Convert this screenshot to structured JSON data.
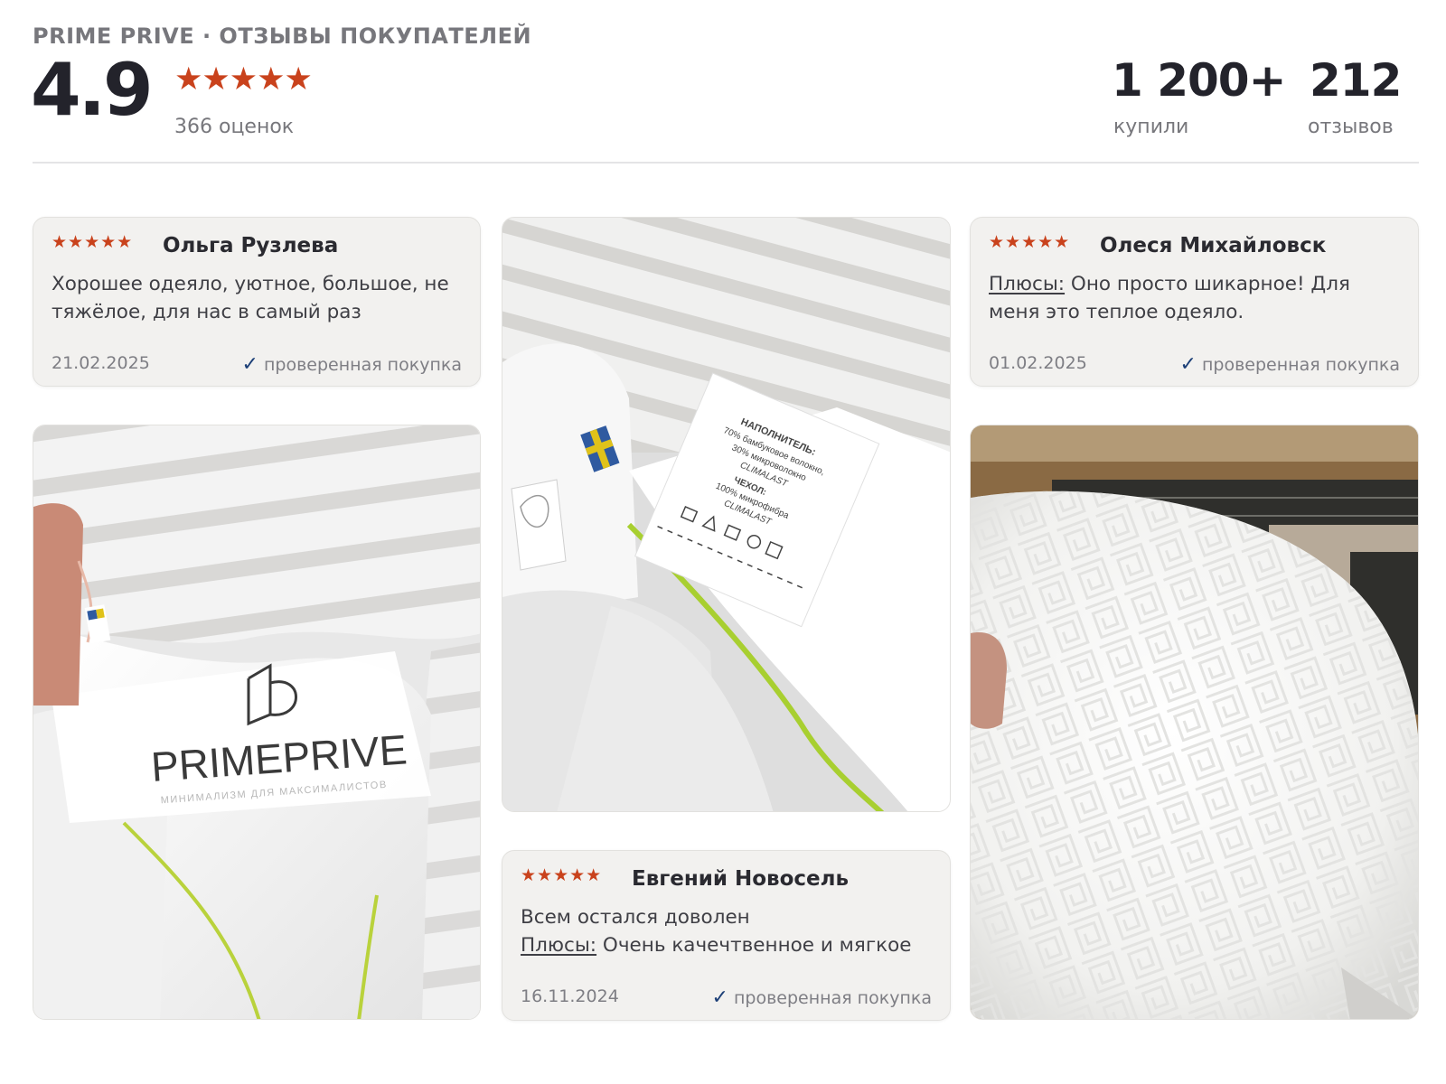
{
  "header": {
    "brand_line": "PRIME PRIVE · ОТЗЫВЫ ПОКУПАТЕЛЕЙ",
    "rating": "4.9",
    "stars": "★★★★★",
    "ratings_count": "366 оценок",
    "stats": [
      {
        "value": "1 200+",
        "label": "купили"
      },
      {
        "value": "212",
        "label": "отзывов"
      }
    ]
  },
  "reviews": [
    {
      "stars": "★★★★★",
      "author": "Ольга Рузлева",
      "text": "Хорошее одеяло, уютное, большое, не тяжёлое, для нас в самый раз",
      "date": "21.02.2025",
      "verified": "проверенная покупка"
    },
    {
      "stars": "★★★★★",
      "author": "Олеся Михайловск",
      "pros_label": "Плюсы:",
      "text": "Оно просто шикарное! Для меня это теплое одеяло.",
      "date": "01.02.2025",
      "verified": "проверенная покупка"
    },
    {
      "stars": "★★★★★",
      "author": "Евгений Новосель",
      "text": "Всем остался доволен",
      "pros_label": "Плюсы:",
      "pros_text": "Очень качечтвенное и мягкое",
      "date": "16.11.2024",
      "verified": "проверенная покупка"
    }
  ],
  "photos": {
    "photo_1_logo": "PRIMEPRIVE",
    "photo_1_tagline": "МИНИМАЛИЗМ ДЛЯ МАКСИМАЛИСТОВ",
    "photo_2_label_lines": [
      "НАПОЛНИТЕЛЬ:",
      "70% бамбуковое волокно,",
      "30% микроволокно",
      "CLIMALAST",
      "ЧЕХОЛ:",
      "100% микрофибра",
      "CLIMALAST"
    ]
  },
  "colors": {
    "star": "#c9421c",
    "check": "#1c3f77",
    "card_bg": "#f2f1ef"
  }
}
